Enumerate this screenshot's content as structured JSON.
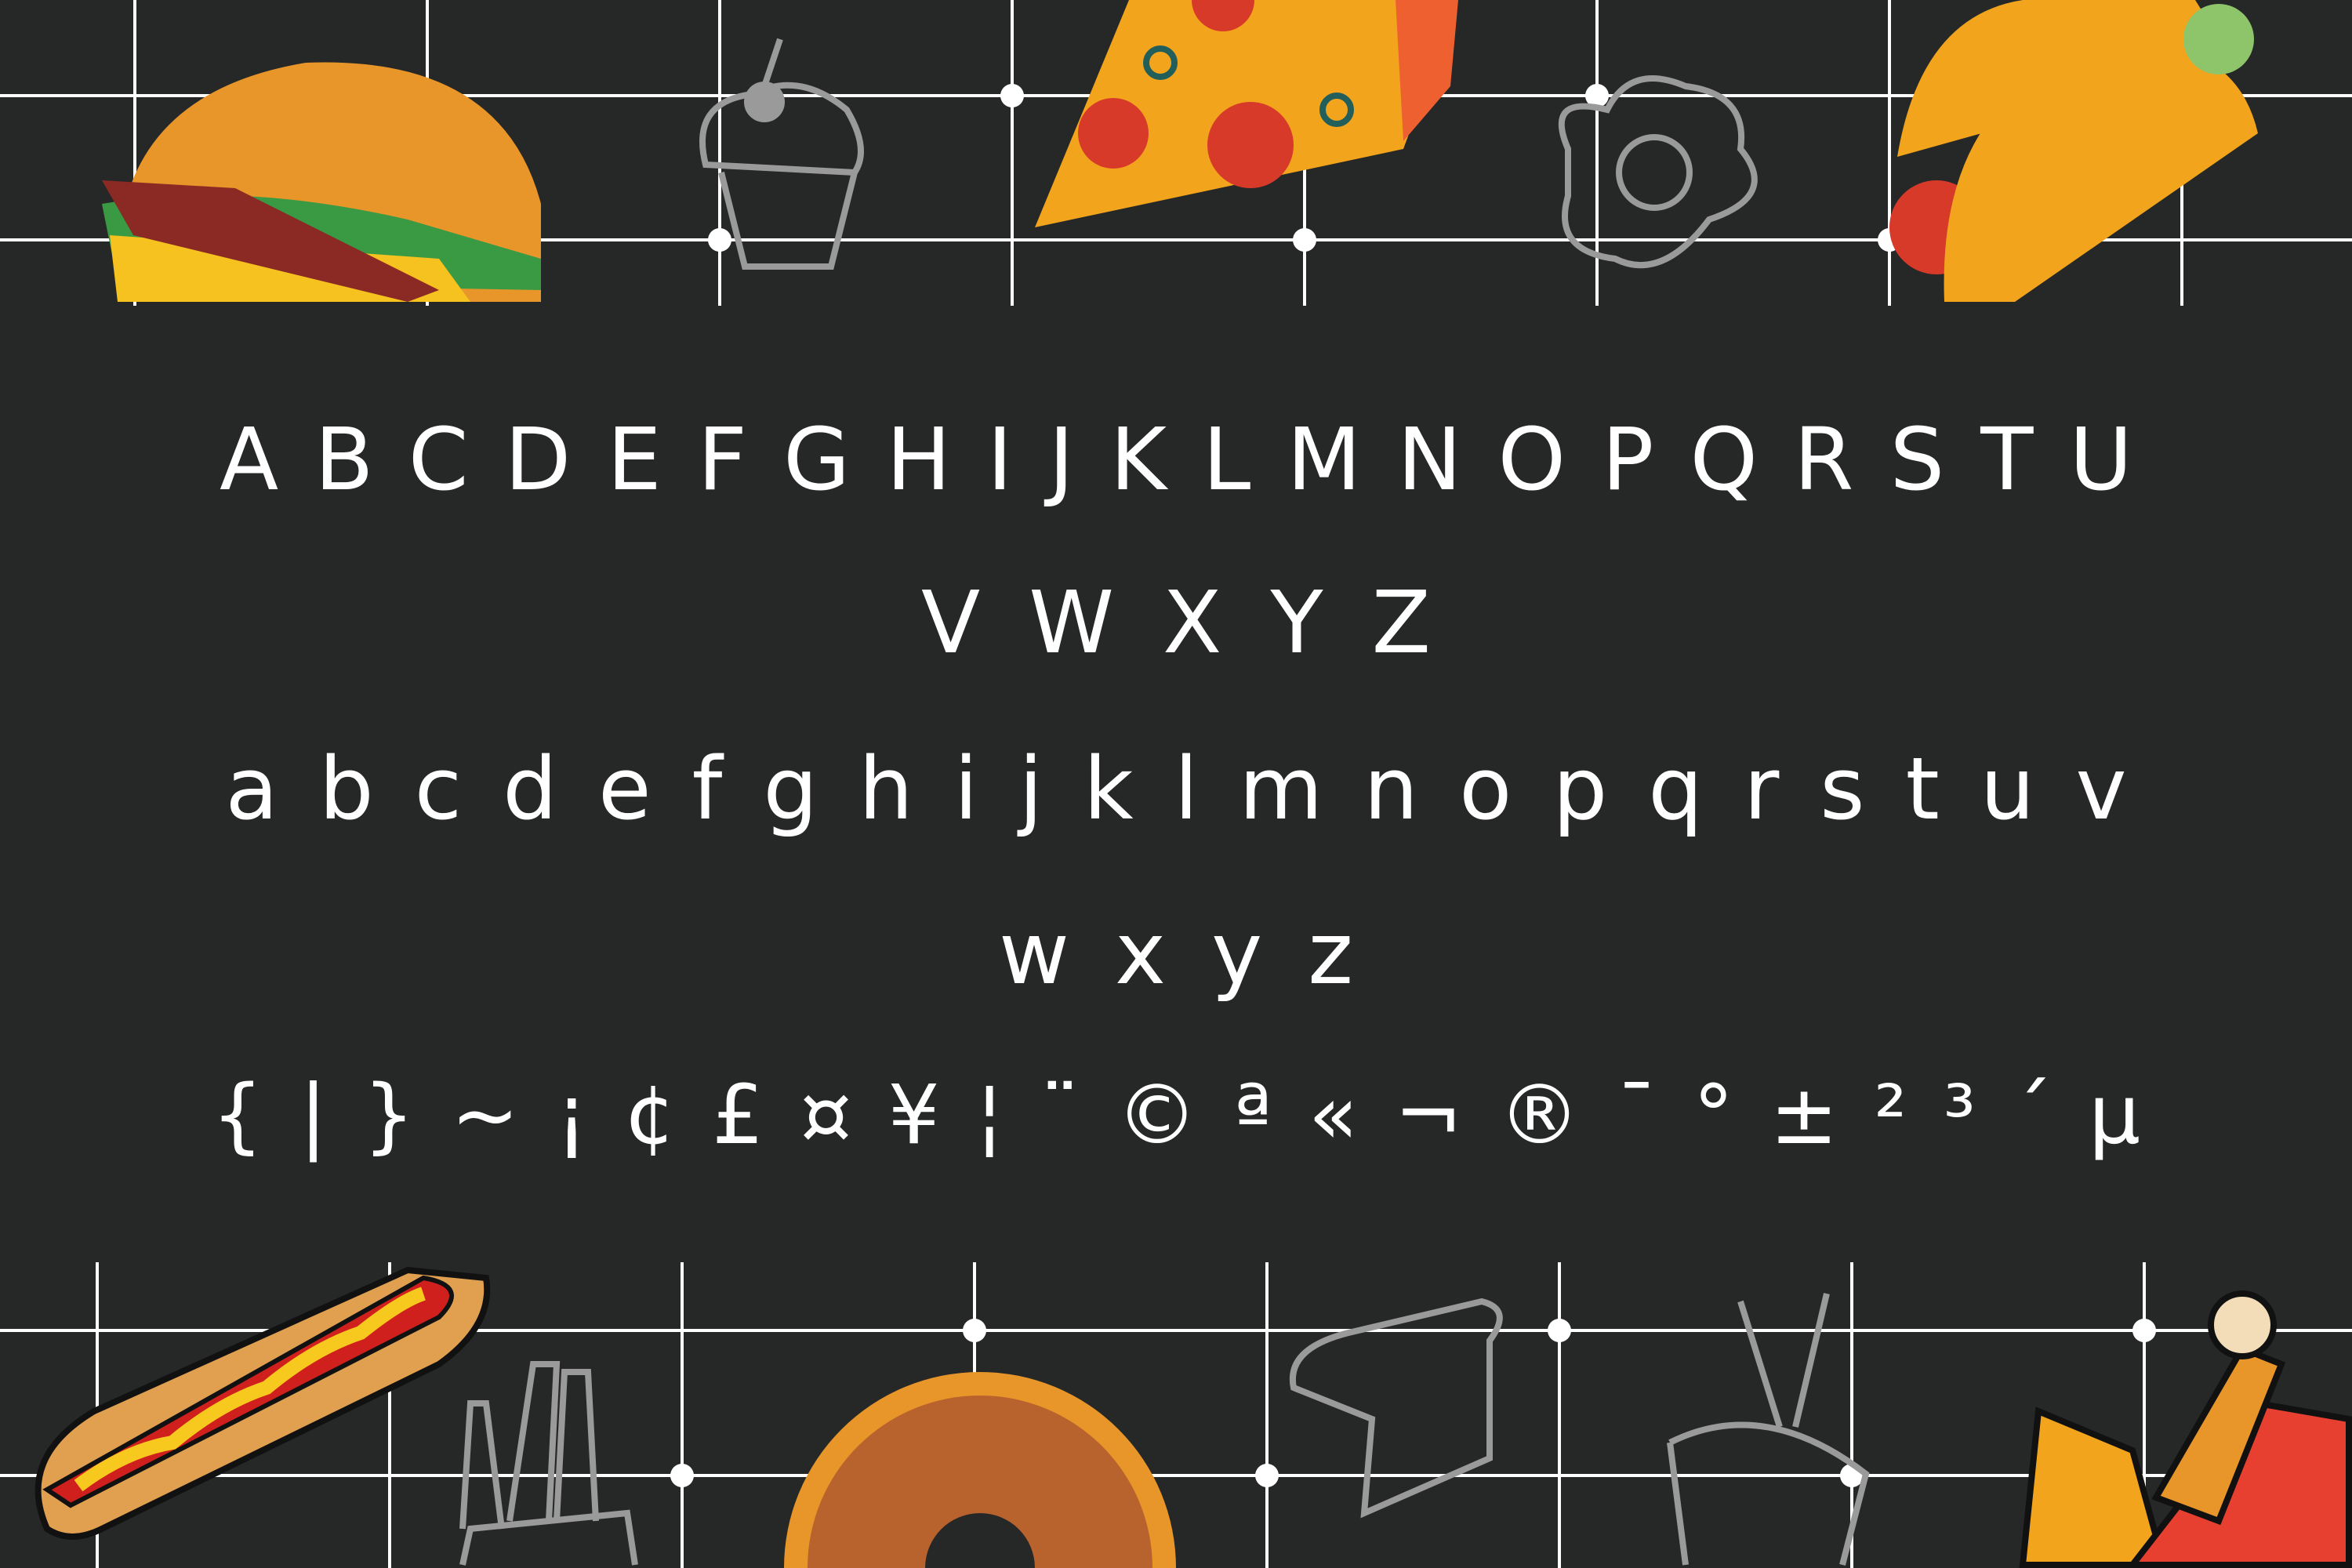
{
  "specimen": {
    "uppercase_line1": "ABCDEFGHIJKLMNOPQRSTU",
    "uppercase_line2": "VWXYZ",
    "lowercase_line1": "abcdefghijklmnopqrstuv",
    "lowercase_line2": "wxyz",
    "symbols": "{|}~¡¢£¤¥¦¨©ª«¬®¯°±²³´µ"
  },
  "colors": {
    "background": "#262828",
    "text": "#ffffff",
    "grid": "#ffffff",
    "outline_icon": "#9a9a9a"
  },
  "decorations": {
    "top": [
      "burger-icon",
      "cupcake-icon",
      "pizza-slice-icon",
      "fried-egg-icon",
      "taco-icon"
    ],
    "bottom": [
      "hotdog-icon",
      "fries-icon",
      "donut-icon",
      "bread-icon",
      "noodle-bowl-icon",
      "chicken-leg-icon"
    ]
  }
}
